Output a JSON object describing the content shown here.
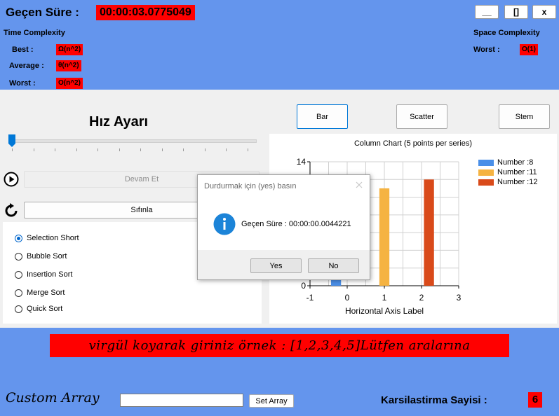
{
  "header": {
    "elapsed_label": "Geçen Süre :",
    "elapsed_value": "00:00:03.0775049",
    "window_buttons": {
      "minimize": "__",
      "maximize": "[]",
      "close": "x"
    },
    "time_complexity": {
      "title": "Time Complexity",
      "best_label": "Best :",
      "best_value": "Ω(n^2)",
      "average_label": "Average :",
      "average_value": "θ(n^2)",
      "worst_label": "Worst :",
      "worst_value": "O(n^2)"
    },
    "space_complexity": {
      "title": "Space Complexity",
      "worst_label": "Worst :",
      "worst_value": "O(1)"
    }
  },
  "left_panel": {
    "speed_title": "Hız Ayarı",
    "slider_value_fraction": 0,
    "continue_label": "Devam Et",
    "reset_label": "Sıfınla",
    "algorithms": [
      {
        "label": "Selection Short",
        "checked": true
      },
      {
        "label": "Bubble Sort",
        "checked": false
      },
      {
        "label": "Insertion Sort",
        "checked": false
      },
      {
        "label": "Merge Sort",
        "checked": false
      },
      {
        "label": "Quick Sort",
        "checked": false
      }
    ]
  },
  "chart_buttons": {
    "bar": "Bar",
    "scatter": "Scatter",
    "stem": "Stem"
  },
  "chart_data": {
    "type": "bar",
    "title": "Column Chart (5 points per series)",
    "xlabel": "Horizontal Axis Label",
    "ylabel": "",
    "xlim": [
      -1,
      3
    ],
    "ylim": [
      0,
      14
    ],
    "x_ticks": [
      "-1",
      "0",
      "1",
      "2",
      "3"
    ],
    "y_ticks": [
      "0",
      "14"
    ],
    "grid": true,
    "legend_position": "top-right",
    "series": [
      {
        "name": "Number :8",
        "color": "#4a8fe8",
        "x": [
          -0.3
        ],
        "values": [
          8
        ]
      },
      {
        "name": "Number :11",
        "color": "#f5b342",
        "x": [
          1
        ],
        "values": [
          11
        ]
      },
      {
        "name": "Number :12",
        "color": "#d94a1a",
        "x": [
          2.2
        ],
        "values": [
          12
        ]
      }
    ]
  },
  "dialog": {
    "title": "Durdurmak için (yes) basın",
    "message": "Geçen Süre : 00:00:00.0044221",
    "yes_label": "Yes",
    "no_label": "No"
  },
  "bottom": {
    "hint": "virgül koyarak giriniz örnek : [1,2,3,4,5]Lütfen aralarına",
    "custom_array_label": "Custom Array",
    "custom_array_value": "",
    "set_array_label": "Set Array",
    "comparisons_label": "Karsilastirma Sayisi :",
    "comparisons_value": "6"
  },
  "colors": {
    "background": "#6495ED",
    "accent_red": "#ff0000",
    "panel": "#f0f0f0"
  }
}
